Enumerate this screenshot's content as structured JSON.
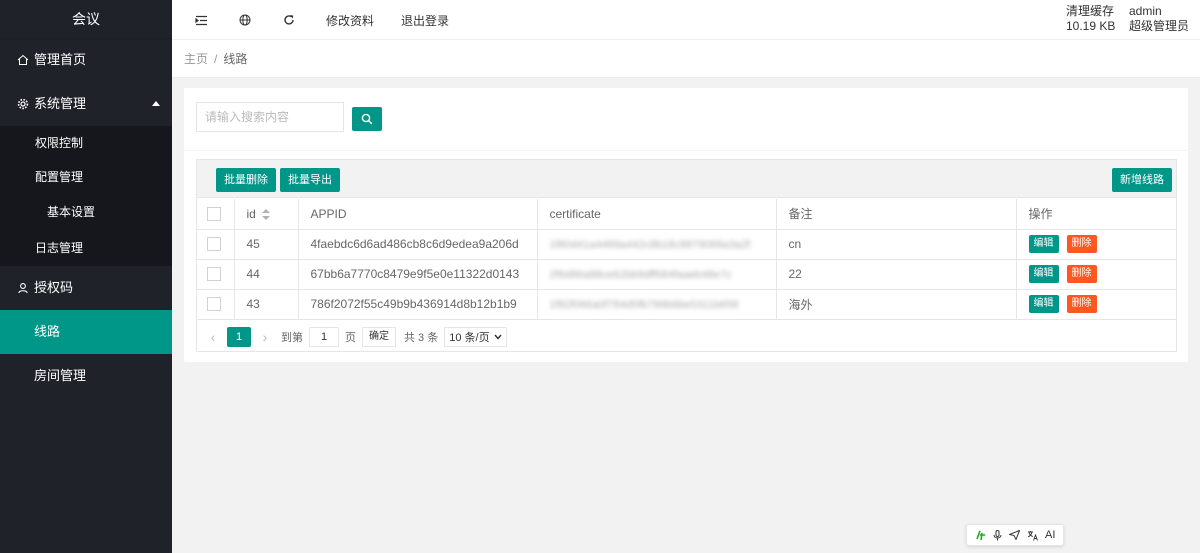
{
  "app": {
    "title": "会议"
  },
  "sidebar": {
    "items": [
      {
        "label": "管理首页",
        "icon": "home-icon"
      },
      {
        "label": "系统管理",
        "icon": "gear-icon",
        "expanded": true,
        "children": [
          {
            "label": "权限控制",
            "expanded": false
          },
          {
            "label": "配置管理",
            "expanded": true,
            "children": [
              {
                "label": "基本设置"
              }
            ]
          },
          {
            "label": "日志管理"
          }
        ]
      },
      {
        "label": "授权码",
        "icon": "user-icon"
      },
      {
        "label": "线路",
        "active": true
      },
      {
        "label": "房间管理"
      }
    ]
  },
  "header": {
    "links": [
      "修改资料",
      "退出登录"
    ],
    "cache": {
      "label": "清理缓存",
      "size": "10.19 KB"
    },
    "user": {
      "name": "admin",
      "role": "超级管理员"
    }
  },
  "breadcrumb": {
    "home": "主页",
    "separator": "/",
    "current": "线路"
  },
  "search": {
    "placeholder": "请输入搜索内容",
    "value": ""
  },
  "toolbar": {
    "batch_delete": "批量删除",
    "batch_export": "批量导出",
    "add": "新增线路"
  },
  "table": {
    "columns": [
      "id",
      "APPID",
      "certificate",
      "备注",
      "操作"
    ],
    "rows": [
      {
        "id": "45",
        "appid": "4faebdc6d6ad486cb8c6d9edea9a206d",
        "certificate": "1f80d41a4489a442c8b18c8879068a3a2f",
        "note": "cn"
      },
      {
        "id": "44",
        "appid": "67bb6a7770c8479e9f5e0e11322d0143",
        "certificate": "2f6d86a88ce62bb9dff684faaeb48e7c",
        "note": "22"
      },
      {
        "id": "43",
        "appid": "786f2072f55c49b9b436914d8b12b1b9",
        "certificate": "1f82f066a0f784d5fb789b6be5311b658",
        "note": "海外"
      }
    ],
    "actions": {
      "edit": "编辑",
      "delete": "删除"
    }
  },
  "pagination": {
    "current_page": "1",
    "goto_prefix": "到第",
    "goto_value": "1",
    "goto_suffix": "页",
    "confirm": "确定",
    "total": "共 3 条",
    "page_size": "10 条/页"
  },
  "float_toolbar": {
    "ai_label": "AI"
  },
  "colors": {
    "sidebar_bg": "#20222a",
    "accent": "#009688",
    "danger": "#ff5722"
  }
}
